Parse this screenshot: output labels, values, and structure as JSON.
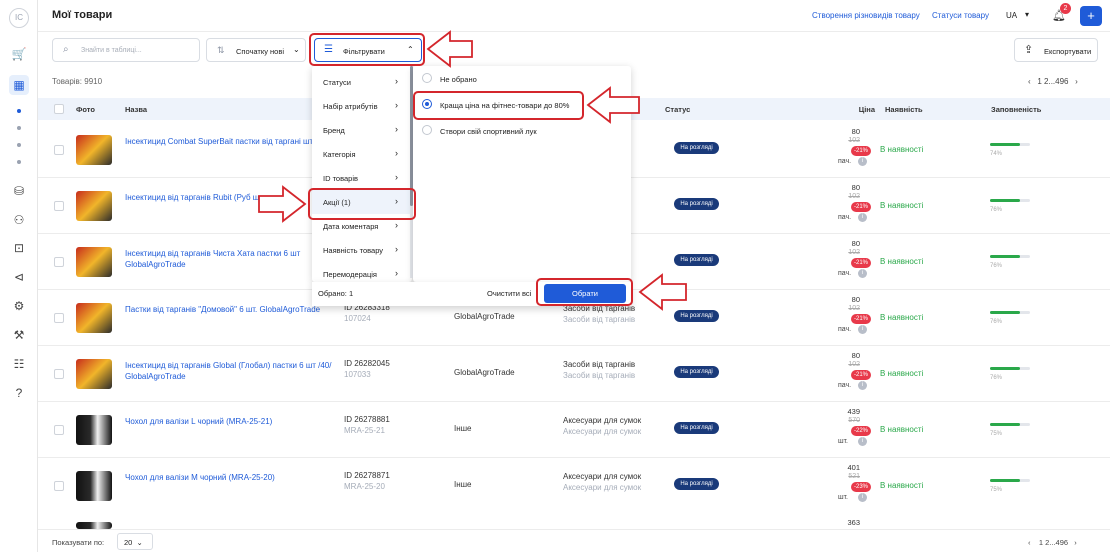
{
  "sidebar": {
    "logo_text": "IC",
    "icons": [
      "cart-icon",
      "store-icon",
      "bag-icon",
      "people-icon",
      "briefcase-icon",
      "megaphone-icon",
      "settings-icon",
      "tools-icon",
      "chat-icon",
      "help-icon"
    ]
  },
  "header": {
    "title": "Мої товари",
    "link_variations": "Створення різновидів товару",
    "link_statuses": "Статуси товару",
    "lang": "UA",
    "notifications_count": "2",
    "add_button": "+"
  },
  "toolbar": {
    "search_placeholder": "Знайти в таблиці...",
    "sort_label": "Спочатку нові",
    "filter_label": "Фільтрувати",
    "export_label": "Експортувати"
  },
  "summary": {
    "count": "Товарів: 9910",
    "pagination": "1  2...496"
  },
  "table": {
    "columns": {
      "photo": "Фото",
      "name": "Назва",
      "status": "Статус",
      "price": "Ціна",
      "availability": "Наявність",
      "completeness": "Заповненість"
    },
    "rows": [
      {
        "name": "Інсектицид Combat SuperBait пастки від таргані шт)",
        "id": "",
        "code": "",
        "brand": "",
        "category": "",
        "category_sub": "ів",
        "status": "На розгляді",
        "price": "80",
        "old_price": "102",
        "discount": "-21%",
        "unit": "пач.",
        "availability": "В наявності",
        "fill_pct": "74%",
        "fill": 0.74,
        "img": "bait"
      },
      {
        "name": "Інсектицид від тарганів Rubit (Руб шт",
        "id": "",
        "code": "",
        "brand": "",
        "category": "",
        "category_sub": "ів",
        "status": "На розгляді",
        "price": "80",
        "old_price": "102",
        "discount": "-21%",
        "unit": "пач.",
        "availability": "В наявності",
        "fill_pct": "76%",
        "fill": 0.76,
        "img": "bait"
      },
      {
        "name": "Інсектицид від тарганів Чиста Хата пастки 6 шт GlobalAgroTrade",
        "id": "",
        "code": "",
        "brand": "",
        "category": "",
        "category_sub": "ів",
        "status": "На розгляді",
        "price": "80",
        "old_price": "102",
        "discount": "-21%",
        "unit": "пач.",
        "availability": "В наявності",
        "fill_pct": "76%",
        "fill": 0.76,
        "img": "bait"
      },
      {
        "name": "Пастки від тарганів \"Домовой\" 6 шт. GlobalAgroTrade",
        "id": "ID 26283318",
        "code": "107024",
        "brand": "GlobalAgroTrade",
        "category": "Засоби від тарганів",
        "category_sub": "Засоби від тарганів",
        "status": "На розгляді",
        "price": "80",
        "old_price": "102",
        "discount": "-21%",
        "unit": "пач.",
        "availability": "В наявності",
        "fill_pct": "76%",
        "fill": 0.76,
        "img": "bait"
      },
      {
        "name": "Інсектицид від тарганів Global (Глобал) пастки 6 шт /40/ GlobalAgroTrade",
        "id": "ID 26282045",
        "code": "107033",
        "brand": "GlobalAgroTrade",
        "category": "Засоби від тарганів",
        "category_sub": "Засоби від тарганів",
        "status": "На розгляді",
        "price": "80",
        "old_price": "102",
        "discount": "-21%",
        "unit": "пач.",
        "availability": "В наявності",
        "fill_pct": "76%",
        "fill": 0.76,
        "img": "bait"
      },
      {
        "name": "Чохол для валізи L чорний (MRA-25-21)",
        "id": "ID 26278881",
        "code": "MRA-25-21",
        "brand": "Інше",
        "category": "Аксесуари для сумок",
        "category_sub": "Аксесуари для сумок",
        "status": "На розгляді",
        "price": "439",
        "old_price": "570",
        "discount": "-22%",
        "unit": "шт.",
        "availability": "В наявності",
        "fill_pct": "75%",
        "fill": 0.75,
        "img": "bag"
      },
      {
        "name": "Чохол для валізи M чорний (MRA-25-20)",
        "id": "ID 26278871",
        "code": "MRA-25-20",
        "brand": "Інше",
        "category": "Аксесуари для сумок",
        "category_sub": "Аксесуари для сумок",
        "status": "На розгляді",
        "price": "401",
        "old_price": "521",
        "discount": "-23%",
        "unit": "шт.",
        "availability": "В наявності",
        "fill_pct": "75%",
        "fill": 0.75,
        "img": "bag"
      }
    ],
    "partial_price": "363"
  },
  "filter_dropdown": {
    "categories": [
      {
        "label": "Статуси"
      },
      {
        "label": "Набір атрибутів"
      },
      {
        "label": "Бренд"
      },
      {
        "label": "Категорія"
      },
      {
        "label": "ID товарів"
      },
      {
        "label": "Акції (1)"
      },
      {
        "label": "Дата коментаря"
      },
      {
        "label": "Наявність товару"
      },
      {
        "label": "Перемодерація"
      }
    ],
    "options": [
      {
        "label": "Не обрано",
        "checked": false
      },
      {
        "label": "Краща ціна на фітнес-товари до 80%",
        "checked": true
      },
      {
        "label": "Створи свій спортивний лук",
        "checked": false
      }
    ],
    "selected_count": "Обрано: 1",
    "clear_label": "Очистити всі",
    "apply_label": "Обрати"
  },
  "footer": {
    "per_page_label": "Показувати по:",
    "per_page_value": "20",
    "pagination": "1  2...496"
  },
  "colors": {
    "accent": "#1f5bd8",
    "status_badge": "#1a3a7a",
    "available": "#2aa84a",
    "discount": "#e8394a",
    "highlight": "#d4262c"
  }
}
